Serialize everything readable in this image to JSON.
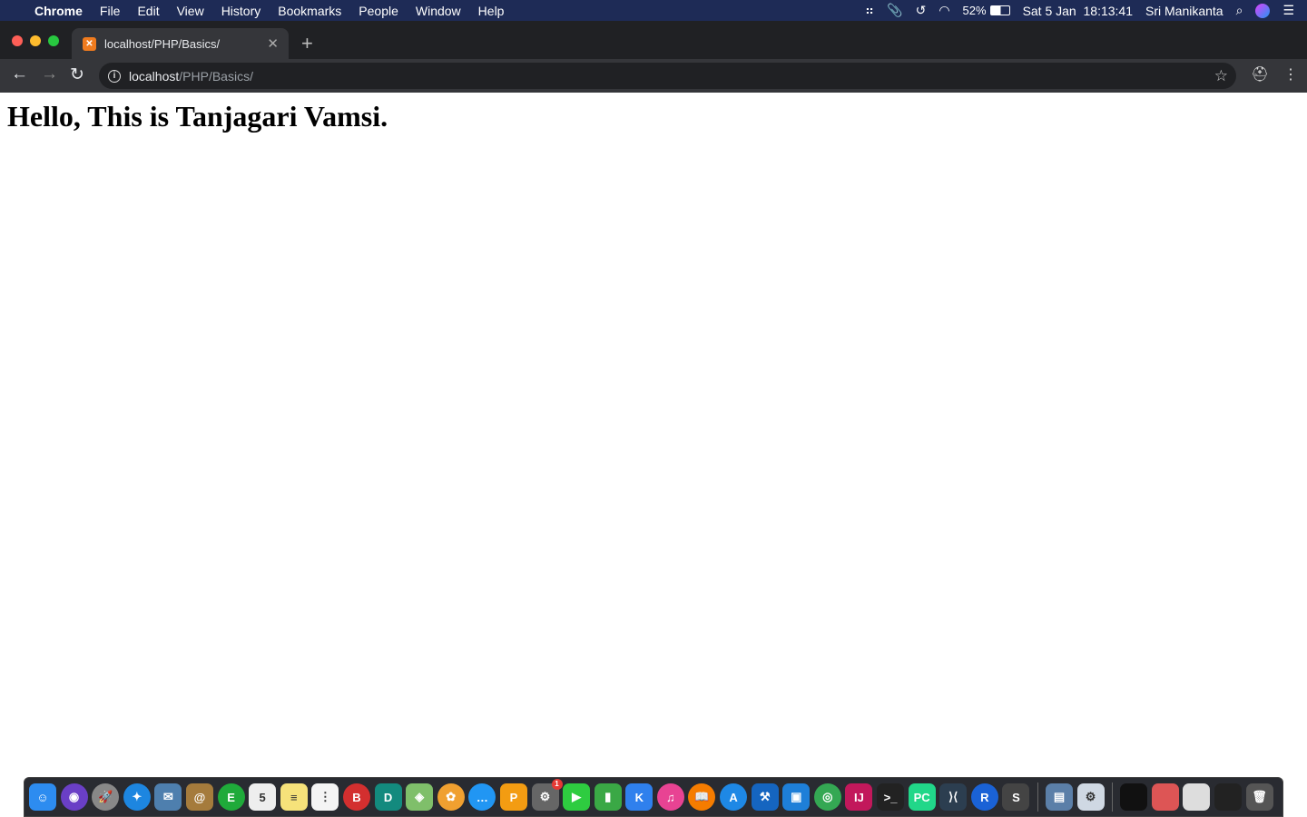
{
  "menubar": {
    "app": "Chrome",
    "items": [
      "File",
      "Edit",
      "View",
      "History",
      "Bookmarks",
      "People",
      "Window",
      "Help"
    ],
    "status": {
      "battery": "52%",
      "datetime": "Sat 5 Jan  18:13:41",
      "user": "Sri Manikanta"
    }
  },
  "browser": {
    "tab_title": "localhost/PHP/Basics/",
    "url_host": "localhost",
    "url_path": "/PHP/Basics/"
  },
  "page": {
    "heading": "Hello, This is Tanjagari Vamsi."
  },
  "dock": {
    "apps": [
      {
        "name": "finder",
        "color": "#2d8cf0",
        "g": "☺"
      },
      {
        "name": "siri",
        "color": "#6a3fc6",
        "g": "◉"
      },
      {
        "name": "launchpad",
        "color": "#888",
        "g": "🚀"
      },
      {
        "name": "safari",
        "color": "#1d86e0",
        "g": "✦"
      },
      {
        "name": "mail",
        "color": "#4e7fae",
        "g": "✉"
      },
      {
        "name": "contacts",
        "color": "#a57b3c",
        "g": "@"
      },
      {
        "name": "evernote",
        "color": "#1faa3a",
        "g": "E"
      },
      {
        "name": "calendar",
        "color": "#eee",
        "g": "5"
      },
      {
        "name": "notes",
        "color": "#f6e27a",
        "g": "≡"
      },
      {
        "name": "reminders",
        "color": "#f4f4f4",
        "g": "⋮"
      },
      {
        "name": "bear",
        "color": "#d32f2f",
        "g": "B"
      },
      {
        "name": "dashlane",
        "color": "#138a7e",
        "g": "D"
      },
      {
        "name": "maps",
        "color": "#7fbf6a",
        "g": "◈"
      },
      {
        "name": "photos",
        "color": "#f0a030",
        "g": "✿"
      },
      {
        "name": "messages",
        "color": "#2196f3",
        "g": "…"
      },
      {
        "name": "pages",
        "color": "#f39c12",
        "g": "P"
      },
      {
        "name": "system-preferences",
        "color": "#666",
        "g": "⚙"
      },
      {
        "name": "facetime",
        "color": "#2ecc40",
        "g": "▶"
      },
      {
        "name": "numbers",
        "color": "#3aa845",
        "g": "▮"
      },
      {
        "name": "keynote",
        "color": "#2f80ed",
        "g": "K"
      },
      {
        "name": "itunes",
        "color": "#e84393",
        "g": "♫"
      },
      {
        "name": "books",
        "color": "#f57c00",
        "g": "📖"
      },
      {
        "name": "app-store",
        "color": "#1e88e5",
        "g": "A"
      },
      {
        "name": "xcode",
        "color": "#1565c0",
        "g": "⚒"
      },
      {
        "name": "jetbrains-toolbox",
        "color": "#1e7fd8",
        "g": "▣"
      },
      {
        "name": "chrome",
        "color": "#34a853",
        "g": "◎"
      },
      {
        "name": "intellij",
        "color": "#c2185b",
        "g": "IJ"
      },
      {
        "name": "terminal",
        "color": "#222",
        "g": ">_"
      },
      {
        "name": "pycharm",
        "color": "#21d789",
        "g": "PC"
      },
      {
        "name": "vscode",
        "color": "#2c3e50",
        "g": "⟩⟨"
      },
      {
        "name": "r",
        "color": "#1a62d6",
        "g": "R"
      },
      {
        "name": "sublime",
        "color": "#444",
        "g": "S"
      }
    ],
    "others": [
      {
        "name": "preview",
        "color": "#5b7fa8",
        "g": "▤"
      },
      {
        "name": "settings",
        "color": "#cfd8e3",
        "g": "⚙"
      }
    ],
    "windows": [
      {
        "name": "window-1",
        "color": "#111",
        "g": ""
      },
      {
        "name": "window-2",
        "color": "#d55",
        "g": ""
      },
      {
        "name": "window-3",
        "color": "#ddd",
        "g": ""
      },
      {
        "name": "window-4",
        "color": "#222",
        "g": ""
      },
      {
        "name": "trash",
        "color": "#555",
        "g": "🗑"
      }
    ],
    "badge": "1"
  }
}
